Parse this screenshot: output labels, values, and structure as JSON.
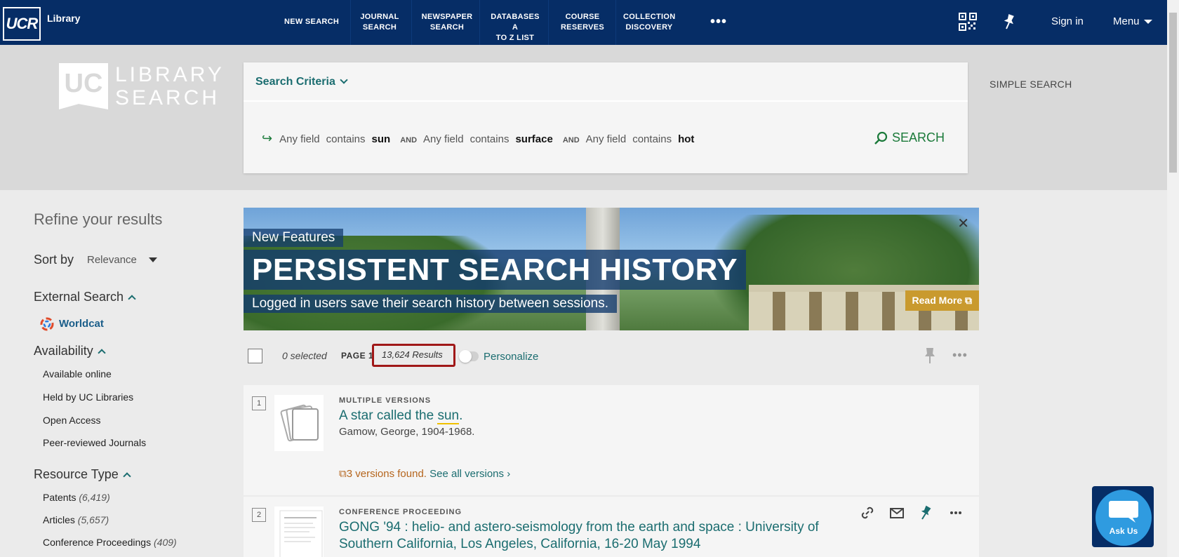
{
  "header": {
    "logo": "UCR",
    "logo_text": "Library",
    "nav": [
      {
        "label_1": "NEW SEARCH",
        "label_2": ""
      },
      {
        "label_1": "JOURNAL",
        "label_2": "SEARCH"
      },
      {
        "label_1": "NEWSPAPER",
        "label_2": "SEARCH"
      },
      {
        "label_1": "DATABASES A",
        "label_2": "TO Z LIST"
      },
      {
        "label_1": "COURSE",
        "label_2": "RESERVES"
      },
      {
        "label_1": "COLLECTION",
        "label_2": "DISCOVERY"
      }
    ],
    "more": "•••",
    "sign_in": "Sign in",
    "menu": "Menu"
  },
  "brand": {
    "uc": "UC",
    "line1": "LIBRARY",
    "line2": "SEARCH"
  },
  "search": {
    "criteria_label": "Search Criteria",
    "query": [
      {
        "field": "Any field",
        "op": "contains",
        "term": "sun"
      },
      {
        "bool": "AND",
        "field": "Any field",
        "op": "contains",
        "term": "surface"
      },
      {
        "bool": "AND",
        "field": "Any field",
        "op": "contains",
        "term": "hot"
      }
    ],
    "button": "SEARCH",
    "simple": "SIMPLE SEARCH"
  },
  "facets": {
    "refine": "Refine your results",
    "sort_label": "Sort by",
    "sort_value": "Relevance",
    "external_search": "External Search",
    "worldcat": "Worldcat",
    "availability": "Availability",
    "availability_items": [
      "Available online",
      "Held by UC Libraries",
      "Open Access",
      "Peer-reviewed Journals"
    ],
    "resource_type": "Resource Type",
    "resource_items": [
      {
        "label": "Patents",
        "count": "(6,419)"
      },
      {
        "label": "Articles",
        "count": "(5,657)"
      },
      {
        "label": "Conference Proceedings",
        "count": "(409)"
      }
    ]
  },
  "banner": {
    "kicker": "New Features",
    "headline": "PERSISTENT SEARCH HISTORY",
    "sub": "Logged in users save their search history between sessions.",
    "read_more": "Read More"
  },
  "toolbar": {
    "selected": "0 selected",
    "page": "PAGE 1",
    "results": "13,624 Results",
    "personalize": "Personalize"
  },
  "results": [
    {
      "num": "1",
      "type": "MULTIPLE VERSIONS",
      "title_a": "A star called the ",
      "title_hl": "sun",
      "title_b": ".",
      "author": "Gamow, George, 1904-1968.",
      "versions": "3 versions found.",
      "see_all": "See all versions"
    },
    {
      "num": "2",
      "type": "CONFERENCE PROCEEDING",
      "title_line1": "GONG '94 : helio- and astero-seismology from the earth and space : University of",
      "title_line2": "Southern California, Los Angeles, California, 16-20 May 1994"
    }
  ],
  "askus": "Ask Us"
}
